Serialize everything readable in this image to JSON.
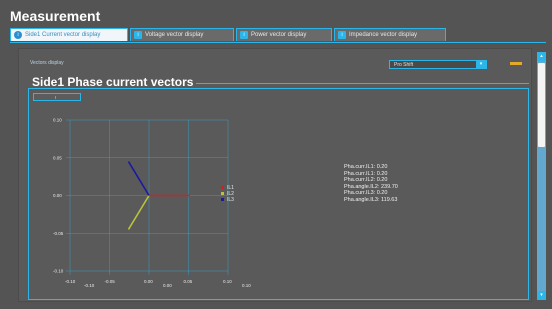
{
  "window": {
    "title": "Measurement"
  },
  "tabs": [
    {
      "label": "Side1 Current vector display",
      "active": true,
      "icon": "info-icon"
    },
    {
      "label": "Voltage vector display",
      "active": false,
      "icon": "info-icon"
    },
    {
      "label": "Power vector display",
      "active": false,
      "icon": "info-icon"
    },
    {
      "label": "Impedance vector display",
      "active": false,
      "icon": "info-icon"
    }
  ],
  "panel": {
    "vectors_label": "Vectors display",
    "dropdown_value": "Pro Shift",
    "section_title": "Side1 Phase current vectors"
  },
  "chart_data": {
    "type": "line",
    "xlim": [
      -0.1,
      0.1
    ],
    "ylim": [
      -0.1,
      0.1
    ],
    "x_ticks": [
      "-0.10",
      "-0.05",
      "0.00",
      "0.05",
      "0.10"
    ],
    "x_ticks_alt": [
      "-0.10",
      "0.00",
      "0.10"
    ],
    "y_ticks": [
      "0.10",
      "0.05",
      "0.00",
      "-0.05",
      "-0.10"
    ],
    "y_ticks_alt": [
      "0.00",
      "-0.05"
    ],
    "grid": true,
    "legend_placement": "right",
    "series": [
      {
        "name": "IL1",
        "color": "#d42020",
        "x": [
          0,
          0.02
        ],
        "y": [
          0,
          0.0
        ]
      },
      {
        "name": "IL2",
        "color": "#b8c23a",
        "x": [
          0,
          -0.01
        ],
        "y": [
          0,
          -0.0173
        ]
      },
      {
        "name": "IL3",
        "color": "#1a1aa0",
        "x": [
          0,
          -0.01
        ],
        "y": [
          0,
          0.0173
        ]
      }
    ],
    "accent_color": "#2bb5e8"
  },
  "readouts": [
    "Pha.curr.IL1: 0.20",
    "Pha.curr.IL1: 0.20",
    "Pha.curr.IL2: 0.20",
    "Pha.angle.IL2: 239.70",
    "Pha.curr.IL3: 0.20",
    "Pha.angle.IL3: 119.63"
  ]
}
